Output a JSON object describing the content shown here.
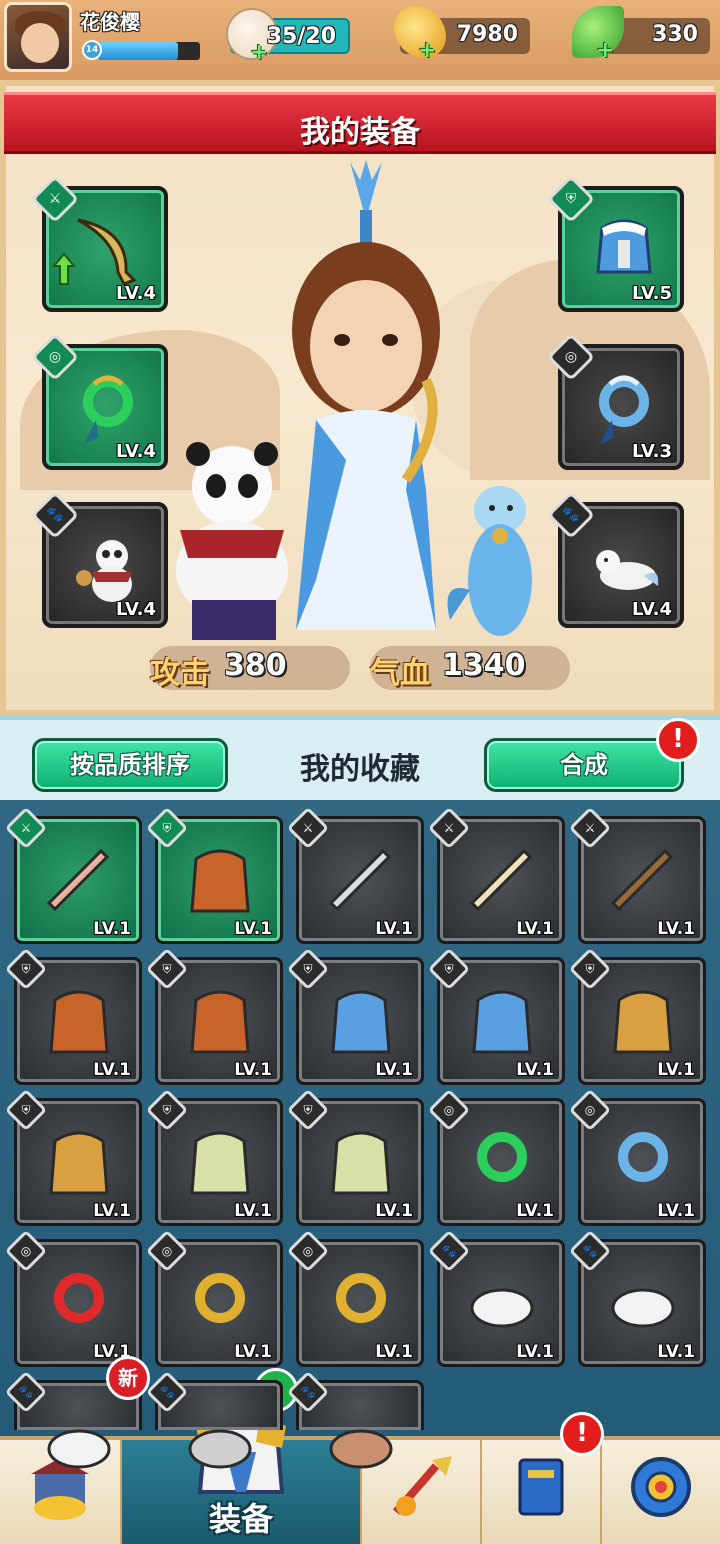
{
  "player": {
    "name": "花俊樱",
    "level": "14",
    "xp_fraction": 0.78
  },
  "resources": {
    "stamina": "35/20",
    "gold": "7980",
    "jade": "330"
  },
  "equipment_panel": {
    "title": "我的装备",
    "left_slots": [
      {
        "type_icon": "weapon-icon",
        "item": "saber",
        "level": "LV.4",
        "quality": "green",
        "upgradable": true
      },
      {
        "type_icon": "accessory-icon",
        "item": "dragon-jade-pendant",
        "level": "LV.4",
        "quality": "green"
      },
      {
        "type_icon": "pet-icon",
        "item": "panda-pet",
        "level": "LV.4",
        "quality": "dark"
      }
    ],
    "right_slots": [
      {
        "type_icon": "armor-icon",
        "item": "blue-fur-armor",
        "level": "LV.5",
        "quality": "green"
      },
      {
        "type_icon": "accessory-icon",
        "item": "ice-dragon-pendant",
        "level": "LV.3",
        "quality": "dark"
      },
      {
        "type_icon": "pet-icon",
        "item": "white-ferret-pet",
        "level": "LV.4",
        "quality": "dark"
      }
    ],
    "attack_label": "攻击",
    "attack_value": "380",
    "hp_label": "气血",
    "hp_value": "1340"
  },
  "collection": {
    "sort_button": "按品质排序",
    "title": "我的收藏",
    "craft_button": "合成",
    "craft_alert": "!",
    "items": [
      {
        "type": "weapon",
        "item": "painted-fan",
        "level": "LV.1",
        "quality": "green"
      },
      {
        "type": "armor",
        "item": "orange-robe",
        "level": "LV.1",
        "quality": "green"
      },
      {
        "type": "weapon",
        "item": "straight-sword",
        "level": "LV.1",
        "quality": "dark"
      },
      {
        "type": "weapon",
        "item": "folding-fan",
        "level": "LV.1",
        "quality": "dark"
      },
      {
        "type": "weapon",
        "item": "crossbow",
        "level": "LV.1",
        "quality": "dark"
      },
      {
        "type": "armor",
        "item": "orange-robe",
        "level": "LV.1",
        "quality": "dark"
      },
      {
        "type": "armor",
        "item": "orange-robe",
        "level": "LV.1",
        "quality": "dark"
      },
      {
        "type": "armor",
        "item": "blue-fur-armor",
        "level": "LV.1",
        "quality": "dark"
      },
      {
        "type": "armor",
        "item": "blue-fur-armor",
        "level": "LV.1",
        "quality": "dark"
      },
      {
        "type": "armor",
        "item": "gold-shoulder-armor",
        "level": "LV.1",
        "quality": "dark"
      },
      {
        "type": "armor",
        "item": "gold-shoulder-armor",
        "level": "LV.1",
        "quality": "dark"
      },
      {
        "type": "armor",
        "item": "green-tunic",
        "level": "LV.1",
        "quality": "dark"
      },
      {
        "type": "armor",
        "item": "green-tunic",
        "level": "LV.1",
        "quality": "dark"
      },
      {
        "type": "accessory",
        "item": "dragon-jade-pendant",
        "level": "LV.1",
        "quality": "dark"
      },
      {
        "type": "accessory",
        "item": "ice-dragon-pendant",
        "level": "LV.1",
        "quality": "dark"
      },
      {
        "type": "accessory",
        "item": "phoenix-pendant",
        "level": "LV.1",
        "quality": "dark"
      },
      {
        "type": "accessory",
        "item": "gold-dragon-pendant",
        "level": "LV.1",
        "quality": "dark"
      },
      {
        "type": "accessory",
        "item": "gold-dragon-pendant",
        "level": "LV.1",
        "quality": "dark"
      },
      {
        "type": "pet",
        "item": "white-squirrel",
        "level": "LV.1",
        "quality": "dark"
      },
      {
        "type": "pet",
        "item": "white-squirrel",
        "level": "LV.1",
        "quality": "dark"
      },
      {
        "type": "pet",
        "item": "white-creature",
        "level": "",
        "quality": "dark",
        "badge": "新"
      },
      {
        "type": "pet",
        "item": "pet",
        "level": "",
        "quality": "dark"
      },
      {
        "type": "pet",
        "item": "monkey",
        "level": "",
        "quality": "dark"
      }
    ]
  },
  "nav": {
    "items": [
      {
        "name": "shop",
        "icon": "treasure-shop-icon",
        "label": ""
      },
      {
        "name": "equipment",
        "icon": "armor-icon",
        "label": "装备",
        "badge": "1",
        "active": true
      },
      {
        "name": "skills",
        "icon": "spear-icon",
        "label": ""
      },
      {
        "name": "book",
        "icon": "book-icon",
        "label": "",
        "alert": "!"
      },
      {
        "name": "settings",
        "icon": "settings-icon",
        "label": ""
      }
    ]
  },
  "colors": {
    "banner_red": "#d31f2c",
    "green_quality": "#128a55",
    "button_green": "#1fc98a",
    "panel_blue": "#2a5a76"
  }
}
